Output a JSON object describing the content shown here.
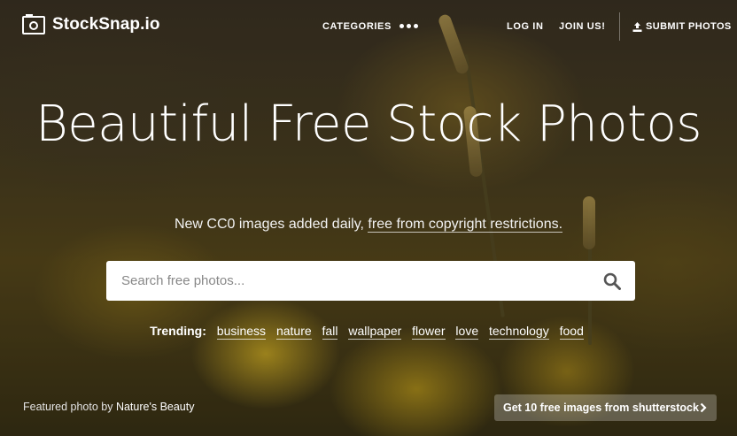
{
  "brand": {
    "name": "StockSnap.io"
  },
  "nav": {
    "categories": "CATEGORIES",
    "login": "LOG IN",
    "join": "JOIN US!",
    "submit": "SUBMIT PHOTOS"
  },
  "hero": {
    "headline": "Beautiful Free Stock Photos",
    "subline_prefix": "New CC0 images added daily, ",
    "subline_link": "free from copyright restrictions."
  },
  "search": {
    "placeholder": "Search free photos..."
  },
  "trending": {
    "label": "Trending:",
    "tags": [
      "business",
      "nature",
      "fall",
      "wallpaper",
      "flower",
      "love",
      "technology",
      "food"
    ]
  },
  "footer": {
    "credit_prefix": "Featured photo by ",
    "credit_author": "Nature's Beauty",
    "promo": "Get 10 free images from shutterstock"
  },
  "colors": {
    "search_bg": "#ffffff",
    "text": "#ffffff"
  }
}
